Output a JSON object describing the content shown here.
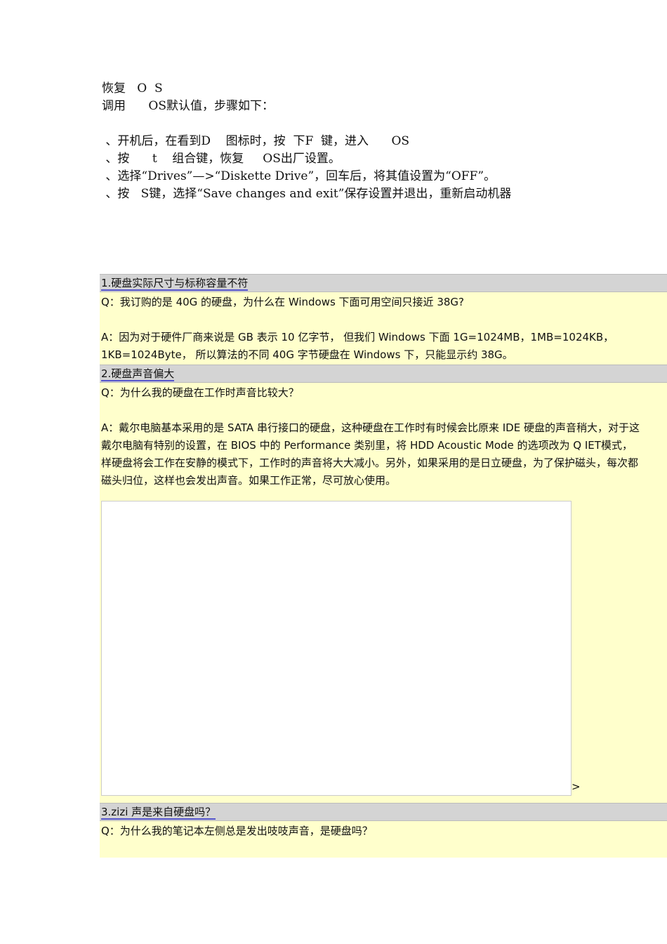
{
  "intro": {
    "title": "恢复   O  S",
    "subtitle": "调用      OS默认值，步骤如下：",
    "steps": [
      " 、开机后，在看到D    图标时，按  下F  键，进入      OS",
      " 、按      t    组合键，恢复     OS出厂设置。",
      " 、选择“Drives”—>“Diskette Drive”，回车后，将其值设置为“OFF”。",
      " 、按   S键，选择“Save changes and exit”保存设置并退出，重新启动机器"
    ]
  },
  "faq": [
    {
      "title": "1.硬盘实际尺寸与标称容量不符",
      "q": "Q：我订购的是 40G 的硬盘，为什么在 Windows 下面可用空间只接近 38G?",
      "a": [
        "A：因为对于硬件厂商来说是 GB  表示  10  亿字节，  但我们 Windows 下面 1G=1024MB，1MB=1024KB，",
        "1KB=1024Byte，  所以算法的不同 40G 字节硬盘在 Windows 下，只能显示约 38G。"
      ]
    },
    {
      "title": "2.硬盘声音偏大",
      "q": "Q：为什么我的硬盘在工作时声音比较大？",
      "a": [
        "A：戴尔电脑基本采用的是 SATA 串行接口的硬盘，这种硬盘在工作时有时候会比原来 IDE 硬盘的声音稍大，对于这",
        "戴尔电脑有特别的设置，在 BIOS 中的 Performance 类别里，将 HDD Acoustic Mode 的选项改为   Q   IET模式，",
        "样硬盘将会工作在安静的模式下，工作时的声音将大大减小。另外，如果采用的是日立硬盘，为了保护磁头，每次都",
        "磁头归位，这样也会发出声音。如果工作正常，尽可放心使用。"
      ],
      "trail": ">"
    },
    {
      "title": "3.zizi 声是来自硬盘吗？",
      "q": "Q：为什么我的笔记本左侧总是发出吱吱声音，是硬盘吗？"
    }
  ]
}
